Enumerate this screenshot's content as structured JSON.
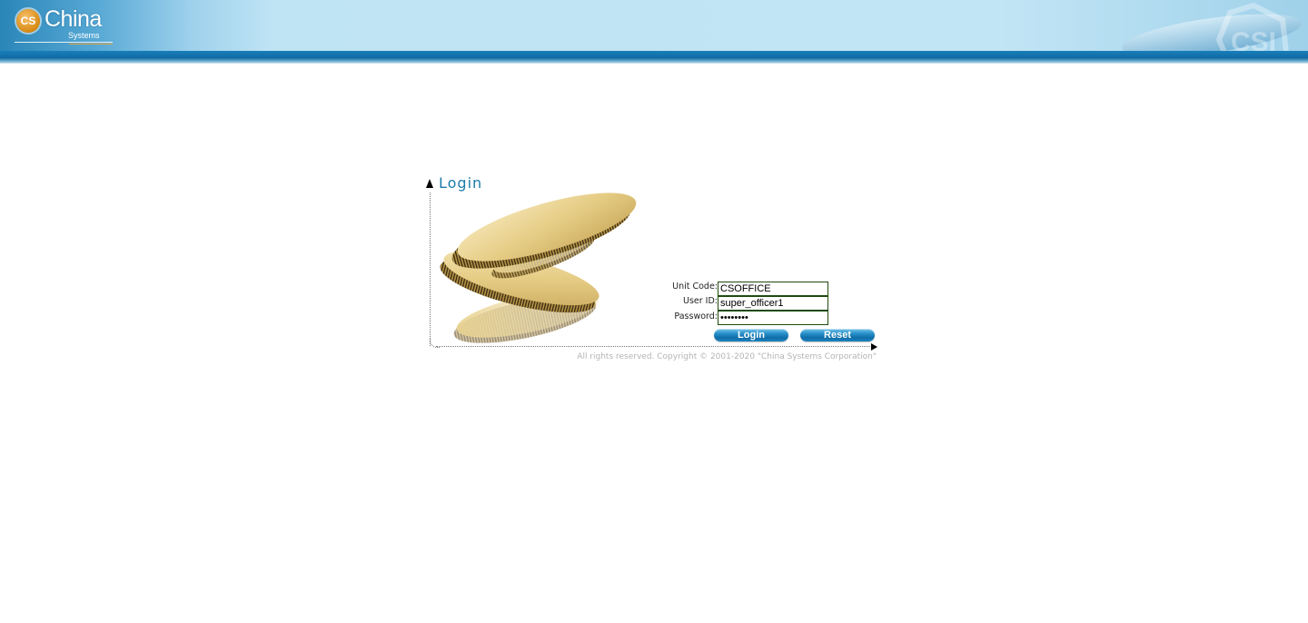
{
  "header": {
    "logo_mark": "CS",
    "logo_name": "China",
    "logo_sub": "Systems",
    "watermark_text": "CSI"
  },
  "login": {
    "title": "Login",
    "fields": {
      "unit_code": {
        "label": "Unit Code:",
        "value": "CSOFFICE"
      },
      "user_id": {
        "label": "User ID:",
        "value": "super_officer1"
      },
      "password": {
        "label": "Password:",
        "value": "••••••••"
      }
    },
    "login_button": "Login",
    "reset_button": "Reset"
  },
  "footer": {
    "copyright": "All rights reserved. Copyright © 2001-2020 \"China Systems Corporation\""
  },
  "colors": {
    "header_blue": "#1a7fb9",
    "title_blue": "#1a7cab",
    "button_blue": "#1b82bf",
    "input_border": "#1f4a0d",
    "logo_orange": "#d88a12"
  },
  "icons": [
    "cs-logo-icon",
    "coins-illustration",
    "triangle-up-icon",
    "triangle-right-icon",
    "csi-watermark-icon"
  ]
}
